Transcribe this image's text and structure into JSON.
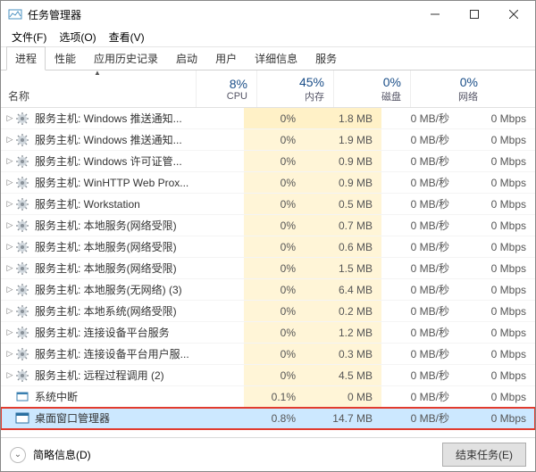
{
  "window": {
    "title": "任务管理器"
  },
  "menu": {
    "file": "文件(F)",
    "options": "选项(O)",
    "view": "查看(V)"
  },
  "tabs": [
    "进程",
    "性能",
    "应用历史记录",
    "启动",
    "用户",
    "详细信息",
    "服务"
  ],
  "columns": {
    "name": "名称",
    "cpu": {
      "pct": "8%",
      "label": "CPU"
    },
    "mem": {
      "pct": "45%",
      "label": "内存"
    },
    "disk": {
      "pct": "0%",
      "label": "磁盘"
    },
    "net": {
      "pct": "0%",
      "label": "网络"
    }
  },
  "processes": [
    {
      "exp": true,
      "icon": "gear",
      "name": "服务主机: Windows 推送通知...",
      "cpu": "0%",
      "mem": "1.8 MB",
      "disk": "0 MB/秒",
      "net": "0 Mbps"
    },
    {
      "exp": true,
      "icon": "gear",
      "name": "服务主机: Windows 推送通知...",
      "cpu": "0%",
      "mem": "1.9 MB",
      "disk": "0 MB/秒",
      "net": "0 Mbps"
    },
    {
      "exp": true,
      "icon": "gear",
      "name": "服务主机: Windows 许可证管...",
      "cpu": "0%",
      "mem": "0.9 MB",
      "disk": "0 MB/秒",
      "net": "0 Mbps"
    },
    {
      "exp": true,
      "icon": "gear",
      "name": "服务主机: WinHTTP Web Prox...",
      "cpu": "0%",
      "mem": "0.9 MB",
      "disk": "0 MB/秒",
      "net": "0 Mbps"
    },
    {
      "exp": true,
      "icon": "gear",
      "name": "服务主机: Workstation",
      "cpu": "0%",
      "mem": "0.5 MB",
      "disk": "0 MB/秒",
      "net": "0 Mbps"
    },
    {
      "exp": true,
      "icon": "gear",
      "name": "服务主机: 本地服务(网络受限)",
      "cpu": "0%",
      "mem": "0.7 MB",
      "disk": "0 MB/秒",
      "net": "0 Mbps"
    },
    {
      "exp": true,
      "icon": "gear",
      "name": "服务主机: 本地服务(网络受限)",
      "cpu": "0%",
      "mem": "0.6 MB",
      "disk": "0 MB/秒",
      "net": "0 Mbps"
    },
    {
      "exp": true,
      "icon": "gear",
      "name": "服务主机: 本地服务(网络受限)",
      "cpu": "0%",
      "mem": "1.5 MB",
      "disk": "0 MB/秒",
      "net": "0 Mbps"
    },
    {
      "exp": true,
      "icon": "gear",
      "name": "服务主机: 本地服务(无网络) (3)",
      "cpu": "0%",
      "mem": "6.4 MB",
      "disk": "0 MB/秒",
      "net": "0 Mbps"
    },
    {
      "exp": true,
      "icon": "gear",
      "name": "服务主机: 本地系统(网络受限)",
      "cpu": "0%",
      "mem": "0.2 MB",
      "disk": "0 MB/秒",
      "net": "0 Mbps"
    },
    {
      "exp": true,
      "icon": "gear",
      "name": "服务主机: 连接设备平台服务",
      "cpu": "0%",
      "mem": "1.2 MB",
      "disk": "0 MB/秒",
      "net": "0 Mbps"
    },
    {
      "exp": true,
      "icon": "gear",
      "name": "服务主机: 连接设备平台用户服...",
      "cpu": "0%",
      "mem": "0.3 MB",
      "disk": "0 MB/秒",
      "net": "0 Mbps"
    },
    {
      "exp": true,
      "icon": "gear",
      "name": "服务主机: 远程过程调用 (2)",
      "cpu": "0%",
      "mem": "4.5 MB",
      "disk": "0 MB/秒",
      "net": "0 Mbps"
    },
    {
      "exp": false,
      "icon": "sys",
      "name": "系统中断",
      "cpu": "0.1%",
      "mem": "0 MB",
      "disk": "0 MB/秒",
      "net": "0 Mbps"
    },
    {
      "exp": false,
      "icon": "dwm",
      "name": "桌面窗口管理器",
      "cpu": "0.8%",
      "mem": "14.7 MB",
      "disk": "0 MB/秒",
      "net": "0 Mbps",
      "selected": true
    }
  ],
  "statusbar": {
    "details": "简略信息(D)",
    "end_task": "结束任务(E)"
  }
}
